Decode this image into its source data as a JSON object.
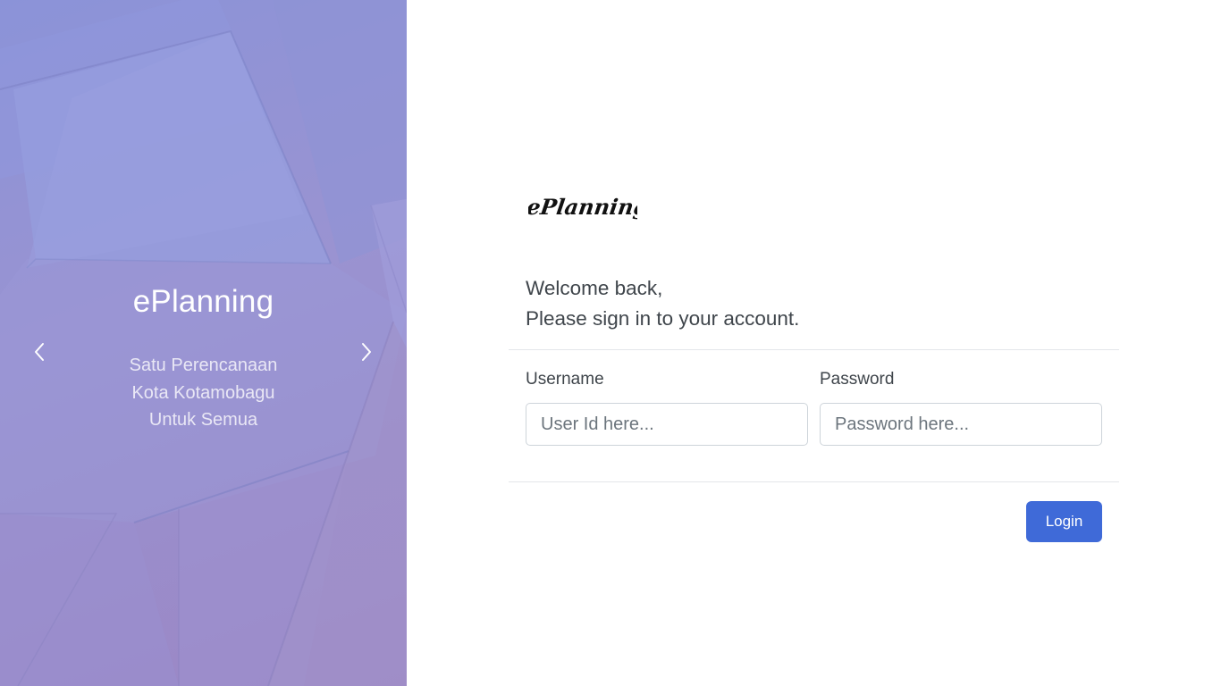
{
  "carousel": {
    "title": "ePlanning",
    "subtitle_lines": [
      "Satu Perencanaan",
      "Kota Kotamobagu",
      "Untuk Semua"
    ],
    "prev_icon": "chevron-left-icon",
    "next_icon": "chevron-right-icon"
  },
  "login": {
    "logo_text": "ePlanning",
    "welcome_line1": "Welcome back,",
    "welcome_line2": "Please sign in to your account.",
    "username_label": "Username",
    "username_placeholder": "User Id here...",
    "username_value": "",
    "password_label": "Password",
    "password_placeholder": "Password here...",
    "password_value": "",
    "submit_label": "Login"
  },
  "colors": {
    "accent": "#3f6ad8",
    "panel_gradient_start": "#8b93d8",
    "panel_gradient_end": "#9b86c4"
  }
}
